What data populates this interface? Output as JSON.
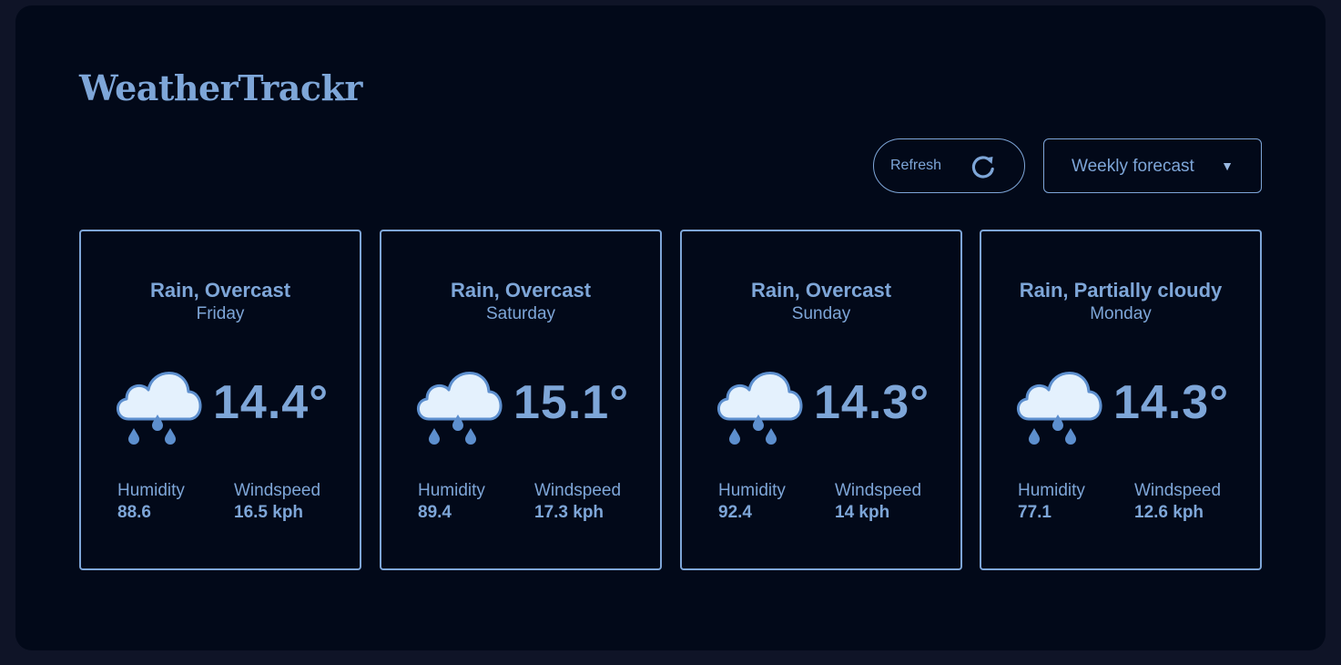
{
  "app": {
    "title": "WeatherTrackr"
  },
  "toolbar": {
    "refresh_label": "Refresh",
    "refresh_icon": "refresh-icon",
    "forecast_select_value": "Weekly forecast",
    "forecast_select_arrow": "▼"
  },
  "labels": {
    "humidity": "Humidity",
    "windspeed": "Windspeed"
  },
  "forecast": [
    {
      "condition": "Rain, Overcast",
      "day": "Friday",
      "temp": "14.4°",
      "humidity": "88.6",
      "windspeed": "16.5 kph",
      "icon": "rain-cloud-icon"
    },
    {
      "condition": "Rain, Overcast",
      "day": "Saturday",
      "temp": "15.1°",
      "humidity": "89.4",
      "windspeed": "17.3 kph",
      "icon": "rain-cloud-icon"
    },
    {
      "condition": "Rain, Overcast",
      "day": "Sunday",
      "temp": "14.3°",
      "humidity": "92.4",
      "windspeed": "14 kph",
      "icon": "rain-cloud-icon"
    },
    {
      "condition": "Rain, Partially cloudy",
      "day": "Monday",
      "temp": "14.3°",
      "humidity": "77.1",
      "windspeed": "12.6 kph",
      "icon": "rain-cloud-icon"
    }
  ],
  "colors": {
    "page_background": "#0f1427",
    "panel_background": "#020919",
    "accent": "#7ea6d8",
    "cloud_fill": "#e4f1fd",
    "cloud_stroke": "#5d8fce"
  }
}
